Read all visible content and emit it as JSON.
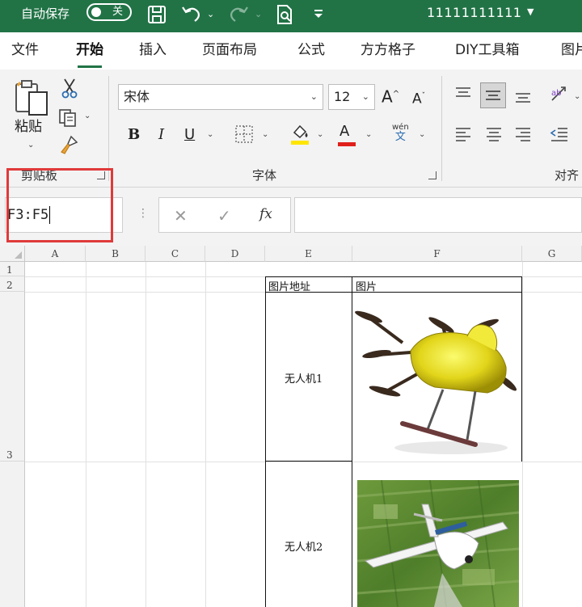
{
  "titlebar": {
    "autosave_label": "自动保存",
    "autosave_state": "关",
    "filename": "11111111111",
    "bg_color": "#217346"
  },
  "menu": {
    "tabs": [
      "文件",
      "开始",
      "插入",
      "页面布局",
      "公式",
      "方方格子",
      "DIY工具箱",
      "图片"
    ],
    "active": "开始"
  },
  "ribbon": {
    "clipboard": {
      "paste_label": "粘贴",
      "group_label": "剪贴板"
    },
    "font": {
      "font_name": "宋体",
      "font_size": "12",
      "group_label": "字体",
      "bold": "B",
      "italic": "I",
      "underline": "U",
      "font_color_letter": "A",
      "phonetic_top": "wén",
      "phonetic_bottom": "文"
    },
    "align": {
      "group_label": "对齐"
    }
  },
  "formula_bar": {
    "name_box": "F3:F5",
    "fx_symbol": "fx",
    "formula": ""
  },
  "sheet": {
    "columns": [
      "A",
      "B",
      "C",
      "D",
      "E",
      "F",
      "G"
    ],
    "rows": [
      "1",
      "2",
      "3"
    ],
    "cells": {
      "E2": "图片地址",
      "F2": "图片",
      "E3": "无人机1",
      "E4": "无人机2"
    },
    "images": [
      {
        "name": "yellow-drone-image",
        "cell": "F3"
      },
      {
        "name": "white-plane-drone-image",
        "cell": "F4"
      }
    ]
  }
}
